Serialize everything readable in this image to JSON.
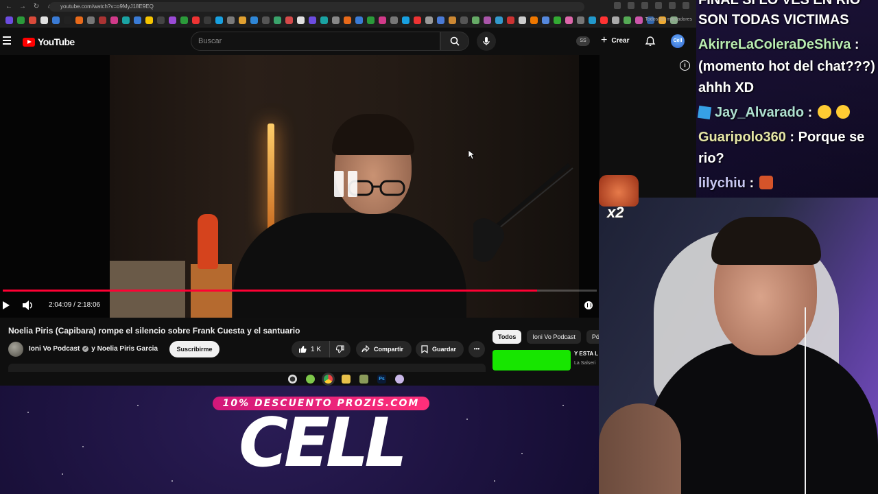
{
  "browser": {
    "url": "youtube.com/watch?v=o9MyJ18E9EQ",
    "bookmarks_label": "Todos los marcadores"
  },
  "youtube": {
    "logo_text": "YouTube",
    "search_placeholder": "Buscar",
    "ss_badge": "SS",
    "create_label": "Crear",
    "avatar_text": "Cell"
  },
  "player": {
    "time_text": "2:04:09 / 2:18:06",
    "progress": 0.9
  },
  "video": {
    "title": "Noelia Piris (Capibara) rompe el silencio sobre Frank Cuesta y el santuario",
    "channel": "Ioni Vo Podcast",
    "channel_joiner": "y Noelia Piris Garcia",
    "subscribe_label": "Suscribirme",
    "likes": "1 K",
    "share_label": "Compartir",
    "save_label": "Guardar",
    "more_label": "•••"
  },
  "chips": [
    {
      "label": "Todos",
      "active": true
    },
    {
      "label": "Ioni Vo Podcast",
      "active": false
    },
    {
      "label": "Pó",
      "active": false
    }
  ],
  "recommendation": {
    "title": "Y ESTA L",
    "channel": "La Salseri"
  },
  "chat": {
    "lines": [
      {
        "text": "FINAL SI LO VES EN RIO"
      },
      {
        "text": "SON TODAS VICTIMAS"
      },
      {
        "user": "AkirreLaColeraDeShiva",
        "sep": ":"
      },
      {
        "text": "(momento hot del chat???)"
      },
      {
        "text": "ahhh XD"
      },
      {
        "user": "Jay_Alvarado",
        "sep": ":"
      },
      {
        "user": "Guaripolo360",
        "sep": ":",
        "msg": "Porque se"
      },
      {
        "text": "rio?"
      },
      {
        "user": "lilychiu",
        "sep": ":"
      }
    ]
  },
  "emote": {
    "count": "x2"
  },
  "sponsor": {
    "promo": "10% DESCUENTO PROZIS.COM",
    "brand": "CELL"
  },
  "colors": {
    "yt_red": "#ff0000",
    "progress_red": "#ff0033",
    "promo_pink": "#ff2f7a",
    "rec_green": "#17e600"
  }
}
